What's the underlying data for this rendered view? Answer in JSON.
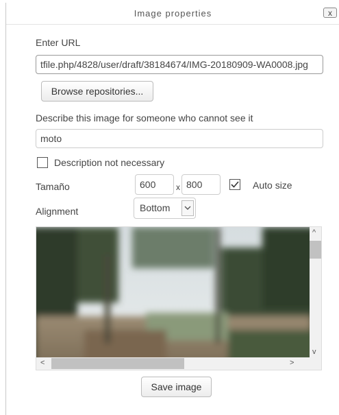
{
  "dialog": {
    "title": "Image properties",
    "close_label": "x"
  },
  "url": {
    "label": "Enter URL",
    "value": "tfile.php/4828/user/draft/38184674/IMG-20180909-WA0008.jpg"
  },
  "browse_button": "Browse repositories...",
  "description": {
    "label": "Describe this image for someone who cannot see it",
    "value": "moto"
  },
  "not_necessary": {
    "label": "Description not necessary",
    "checked": false
  },
  "size": {
    "label": "Tamaño",
    "width": "600",
    "separator": "x",
    "height": "800",
    "auto_label": "Auto size",
    "auto_checked": true
  },
  "alignment": {
    "label": "Alignment",
    "selected": "Bottom"
  },
  "scroll": {
    "up": "^",
    "down": "v",
    "left": "<",
    "right": ">"
  },
  "save_button": "Save image"
}
